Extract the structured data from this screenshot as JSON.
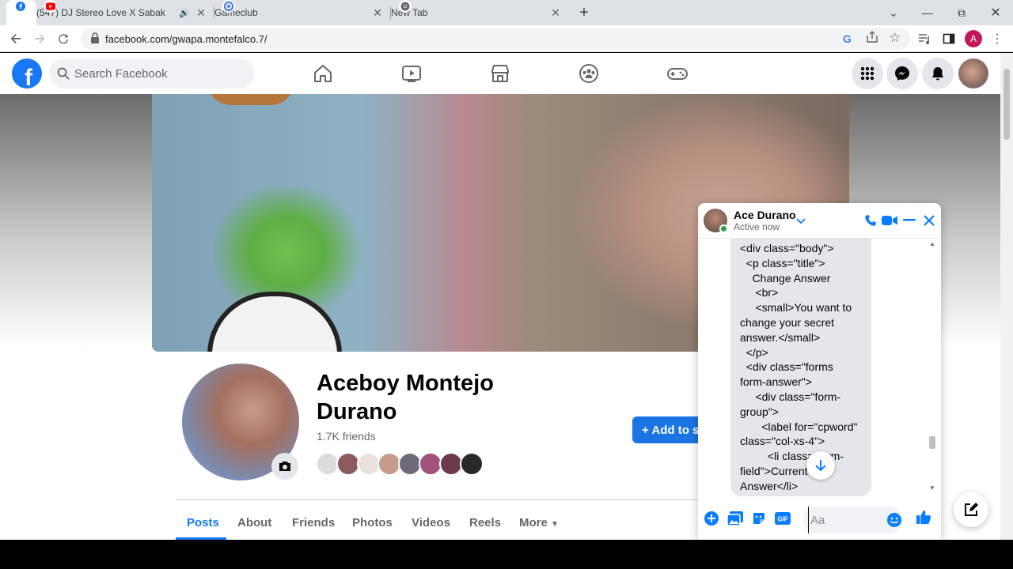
{
  "browser": {
    "tabs": [
      {
        "title": "",
        "icon": "facebook-icon",
        "active": true
      },
      {
        "title": "(547) DJ Stereo Love X Sabak",
        "icon": "youtube-icon",
        "audio": true
      },
      {
        "title": "Gameclub",
        "icon": "gameclub-icon"
      },
      {
        "title": "New Tab",
        "icon": "chrome-icon"
      }
    ],
    "url": "facebook.com/gwapa.montefalco.7/",
    "profile_initial": "A"
  },
  "facebook": {
    "logo_letter": "f",
    "search_placeholder": "Search Facebook",
    "nav": [
      "home",
      "watch",
      "marketplace",
      "groups",
      "gaming"
    ]
  },
  "profile": {
    "name": "Aceboy Montejo Durano",
    "friends": "1.7K friends",
    "add_button": "+ Add to s",
    "tabs": [
      "Posts",
      "About",
      "Friends",
      "Photos",
      "Videos",
      "Reels",
      "More"
    ]
  },
  "chat": {
    "name": "Ace Durano",
    "status": "Active now",
    "message": "<div class=\"body\">\n  <p class=\"title\">\n    Change Answer\n     <br>\n     <small>You want to change your secret answer.</small>\n  </p>\n  <div class=\"forms form-answer\">\n     <div class=\"form-group\">\n       <label for=\"cpword\" class=\"col-xs-4\">\n         <li class=\"form-field\">Current Answer</li>",
    "input_placeholder": "Aa"
  },
  "colors": {
    "brand": "#1877f2",
    "chat_accent": "#0a7cff"
  }
}
